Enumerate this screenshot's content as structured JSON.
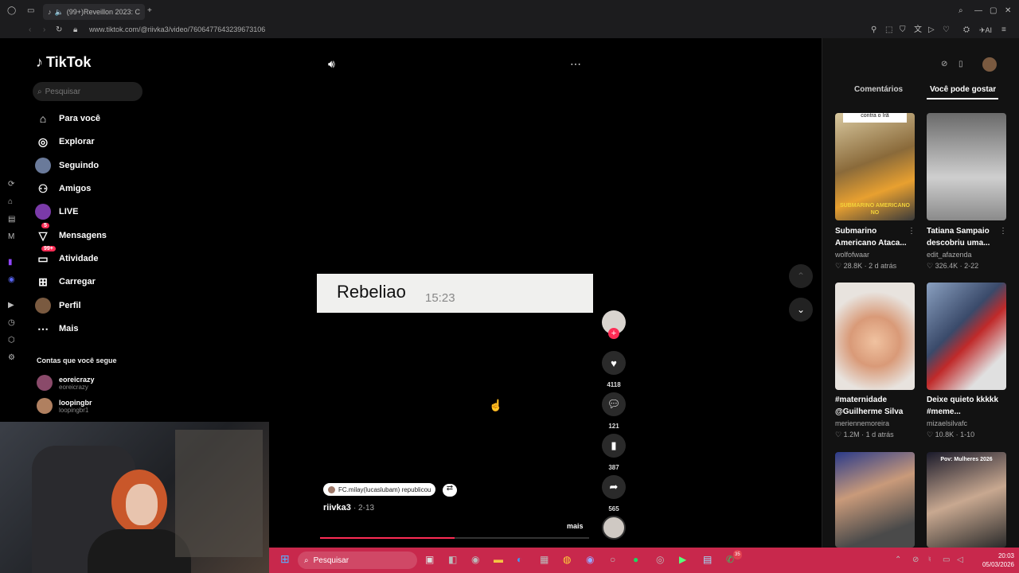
{
  "browser": {
    "tab_title": "(99+)Reveillon 2023: C",
    "url": "www.tiktok.com/@riivka3/video/7606477643239673106"
  },
  "sidebar": {
    "logo": "TikTok",
    "search_placeholder": "Pesquisar",
    "items": [
      {
        "label": "Para você",
        "icon": "home-icon"
      },
      {
        "label": "Explorar",
        "icon": "compass-icon"
      },
      {
        "label": "Seguindo",
        "icon": "following-avatar"
      },
      {
        "label": "Amigos",
        "icon": "friends-icon"
      },
      {
        "label": "LIVE",
        "icon": "live-avatar"
      },
      {
        "label": "Mensagens",
        "icon": "messages-icon",
        "badge": "5"
      },
      {
        "label": "Atividade",
        "icon": "activity-icon",
        "badge": "99+"
      },
      {
        "label": "Carregar",
        "icon": "upload-icon"
      },
      {
        "label": "Perfil",
        "icon": "profile-avatar"
      },
      {
        "label": "Mais",
        "icon": "more-icon"
      }
    ],
    "following_title": "Contas que você segue",
    "accounts": [
      {
        "name": "eoreicrazy",
        "handle": "eoreicrazy"
      },
      {
        "name": "loopingbr",
        "handle": "loopingbr1"
      }
    ]
  },
  "video": {
    "overlay_text": "Rebeliao",
    "overlay_time": "15:23",
    "repost_label": "FC.milay(lucaslubam) republicou",
    "author": "riivka3",
    "date": "2-13",
    "more_label": "mais",
    "progress_fraction": 0.5
  },
  "actions": {
    "likes": "4118",
    "comments": "121",
    "saves": "387",
    "shares": "565"
  },
  "right_panel": {
    "tab_comments": "Comentários",
    "tab_suggestions": "Você pode gostar",
    "cards": [
      {
        "title": "Submarino Americano Ataca...",
        "author": "wolfofwaar",
        "meta": "28.8K · 2 d atrás",
        "thumb_caption_top": "contra o Irã",
        "thumb_caption_bottom": "SUBMARINO AMERICANO NO"
      },
      {
        "title": "Tatiana Sampaio descobriu uma...",
        "author": "edit_afazenda",
        "meta": "326.4K · 2-22"
      },
      {
        "title": "#maternidade @Guilherme Silva",
        "author": "meriennemoreira",
        "meta": "1.2M · 1 d atrás"
      },
      {
        "title": "Deixe quieto kkkkk #meme...",
        "author": "mizaelsilvafc",
        "meta": "10.8K · 1-10"
      },
      {
        "title": "",
        "author": "",
        "meta": ""
      },
      {
        "title": "",
        "author": "",
        "meta": "",
        "thumb_caption_top": "Pov: Mulheres 2026"
      }
    ]
  },
  "taskbar": {
    "search_placeholder": "Pesquisar",
    "time": "20:03",
    "date": "05/03/2026",
    "whatsapp_badge": "35"
  },
  "colors": {
    "accent": "#fe2c55",
    "taskbar": "#c8284c",
    "panel": "#121212"
  }
}
